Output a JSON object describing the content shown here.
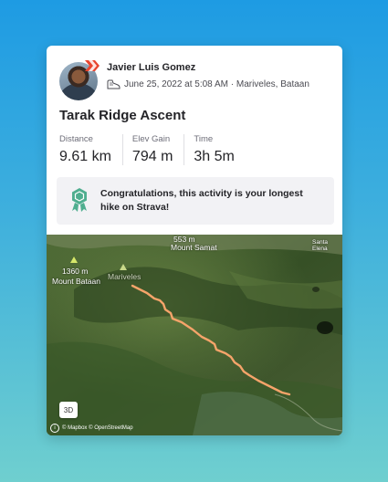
{
  "activity": {
    "athlete_name": "Javier Luis Gomez",
    "meta": "June 25, 2022 at 5:08 AM · Mariveles, Bataan",
    "title": "Tarak Ridge Ascent"
  },
  "stats": [
    {
      "label": "Distance",
      "value": "9.61 km"
    },
    {
      "label": "Elev Gain",
      "value": "794 m"
    },
    {
      "label": "Time",
      "value": "3h 5m"
    }
  ],
  "achievement": {
    "text": "Congratulations, this activity is your longest hike on Strava!"
  },
  "map": {
    "labels": {
      "mount_samat_elev": "553 m",
      "mount_samat_name": "Mount Samat",
      "santa_elena": "Santa Elena",
      "mount_bataan_elev": "1360 m",
      "mount_bataan_name": "Mount Bataan",
      "mariveles": "Mariveles"
    },
    "mode_button": "3D",
    "attribution_info": "i",
    "attribution": "© Mapbox © OpenStreetMap",
    "route_color": "#f6a46a"
  },
  "colors": {
    "accent": "#fc4c02",
    "achievement_icon": "#4fae8f"
  }
}
